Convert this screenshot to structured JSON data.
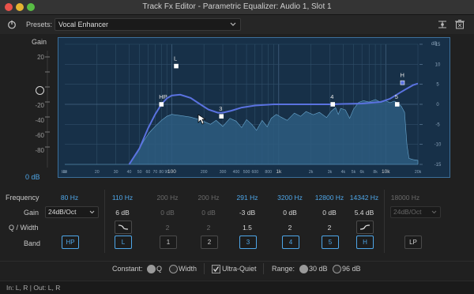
{
  "window": {
    "title": "Track Fx Editor - Parametric Equalizer: Audio 1, Slot 1"
  },
  "toolbar": {
    "presets_label": "Presets:",
    "preset_value": "Vocal Enhancer"
  },
  "gain_axis": {
    "title": "Gain",
    "ticks": [
      "20",
      "0",
      "-20",
      "-40",
      "-60",
      "-80"
    ],
    "value": "0 dB"
  },
  "db_axis": {
    "label": "dB",
    "ticks": [
      "15",
      "10",
      "5",
      "0",
      "-5",
      "-10",
      "-15"
    ]
  },
  "freq_axis": {
    "label": "Hz",
    "ticks": [
      "10",
      "20",
      "30",
      "40",
      "50",
      "60",
      "70",
      "80",
      "90",
      "100",
      "200",
      "300",
      "400",
      "500",
      "600",
      "800",
      "1k",
      "2k",
      "3k",
      "4k",
      "5k",
      "6k",
      "8k",
      "10k",
      "20k"
    ]
  },
  "band_markers": [
    {
      "label": "HP",
      "freq_hz": 80,
      "gain_db": 0
    },
    {
      "label": "L",
      "freq_hz": 110,
      "gain_db": 6
    },
    {
      "label": "3",
      "freq_hz": 291,
      "gain_db": -3
    },
    {
      "label": "4",
      "freq_hz": 3200,
      "gain_db": 0
    },
    {
      "label": "5",
      "freq_hz": 12800,
      "gain_db": 0
    },
    {
      "label": "H",
      "freq_hz": 14342,
      "gain_db": 5.4
    }
  ],
  "params": {
    "labels": {
      "frequency": "Frequency",
      "gain": "Gain",
      "q_width": "Q / Width",
      "band": "Band"
    },
    "hp": {
      "frequency": "80 Hz",
      "slope": "24dB/Oct",
      "band": "HP"
    },
    "bands": [
      {
        "frequency": "110 Hz",
        "gain": "6 dB",
        "q": "",
        "band": "L",
        "active": true,
        "shape": "low-shelf"
      },
      {
        "frequency": "200 Hz",
        "gain": "0 dB",
        "q": "2",
        "band": "1",
        "active": false
      },
      {
        "frequency": "200 Hz",
        "gain": "0 dB",
        "q": "2",
        "band": "2",
        "active": false
      },
      {
        "frequency": "291 Hz",
        "gain": "-3 dB",
        "q": "1.5",
        "band": "3",
        "active": true
      },
      {
        "frequency": "3200 Hz",
        "gain": "0 dB",
        "q": "2",
        "band": "4",
        "active": true
      },
      {
        "frequency": "12800 Hz",
        "gain": "0 dB",
        "q": "2",
        "band": "5",
        "active": true
      },
      {
        "frequency": "14342 Hz",
        "gain": "5.4 dB",
        "q": "",
        "band": "H",
        "active": true,
        "shape": "high-shelf"
      }
    ],
    "lp": {
      "frequency": "18000 Hz",
      "slope": "24dB/Oct",
      "band": "LP"
    }
  },
  "footer_controls": {
    "constant_label": "Constant:",
    "q_label": "Q",
    "width_label": "Width",
    "ultra_quiet_label": "Ultra-Quiet",
    "ultra_quiet_checked": true,
    "range_label": "Range:",
    "range_30": "30 dB",
    "range_96": "96 dB"
  },
  "status": {
    "io": "In: L, R | Out: L, R"
  },
  "colors": {
    "accent": "#4ea6e8",
    "curve": "#5a72e0",
    "spectrum": "#2d5c80"
  }
}
